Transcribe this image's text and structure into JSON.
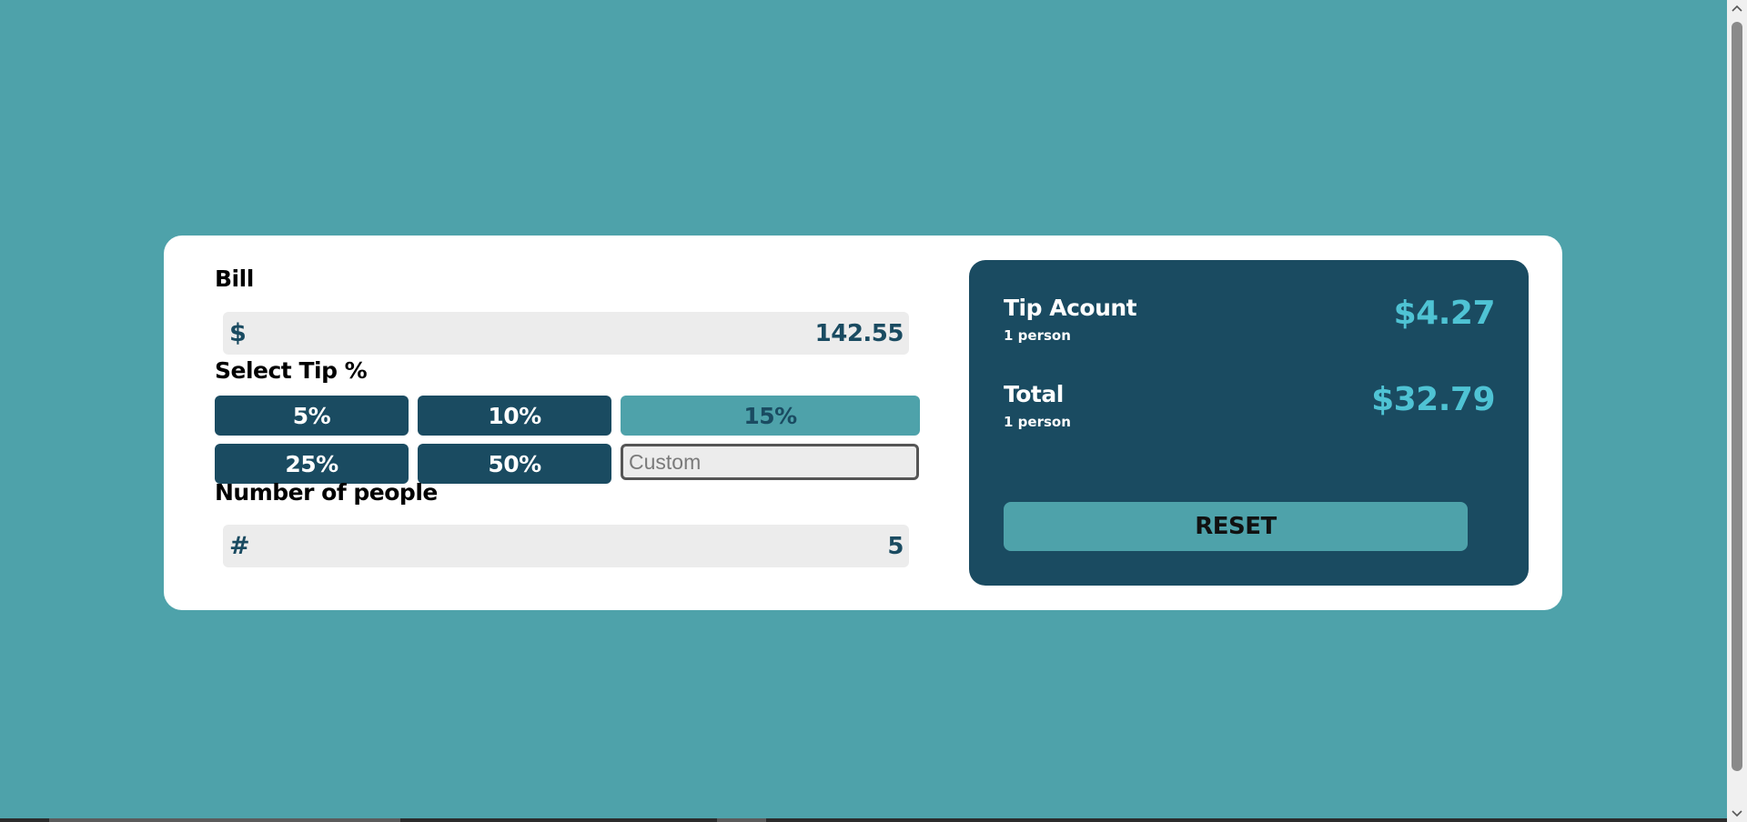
{
  "colors": {
    "background": "#4ea2aa",
    "card": "#ffffff",
    "dark_panel": "#1a4b61",
    "accent": "#4fc3d4",
    "active_tip": "#4ea2aa",
    "input_bg": "#ececec"
  },
  "form": {
    "bill_label": "Bill",
    "bill_prefix": "$",
    "bill_value": "142.55",
    "tip_label": "Select Tip %",
    "tips": [
      {
        "label": "5%",
        "active": false
      },
      {
        "label": "10%",
        "active": false
      },
      {
        "label": "15%",
        "active": true
      },
      {
        "label": "25%",
        "active": false
      },
      {
        "label": "50%",
        "active": false
      }
    ],
    "custom_placeholder": "Custom",
    "people_label": "Number of people",
    "people_prefix": "#",
    "people_value": "5"
  },
  "results": {
    "tip_title": "Tip Acount",
    "tip_sub": "1 person",
    "tip_amount": "$4.27",
    "total_title": "Total",
    "total_sub": "1 person",
    "total_amount": "$32.79",
    "reset_label": "RESET"
  },
  "icons": {
    "scroll_up": "chevron-up-icon",
    "scroll_down": "chevron-down-icon"
  }
}
